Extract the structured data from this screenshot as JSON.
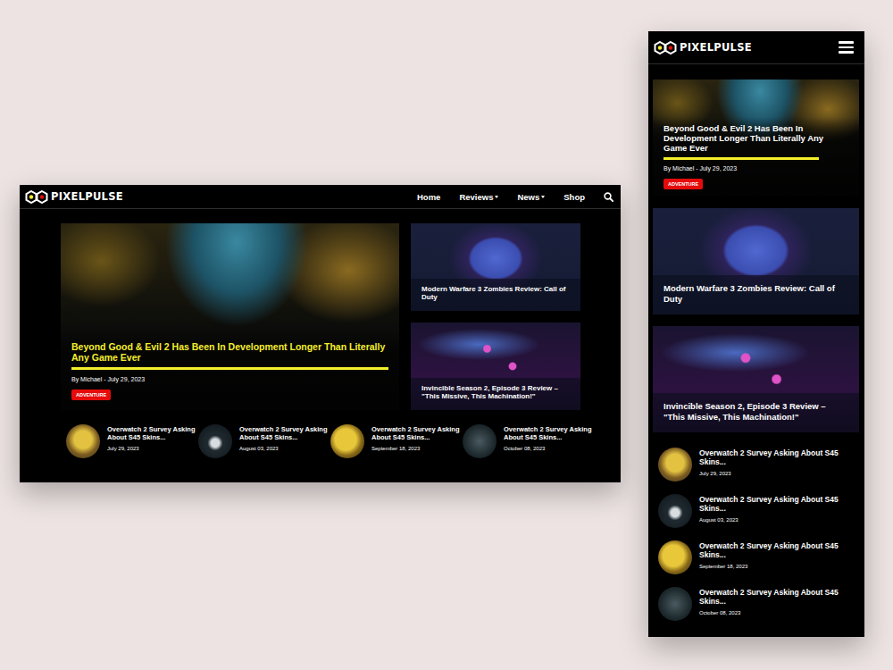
{
  "desktop": {
    "logo": "PIXELPULSE",
    "nav": [
      {
        "label": "Home",
        "dropdown": false
      },
      {
        "label": "Reviews",
        "dropdown": true
      },
      {
        "label": "News",
        "dropdown": true
      },
      {
        "label": "Shop",
        "dropdown": false
      }
    ],
    "hero": {
      "title": "Beyond Good & Evil 2 Has Been In Development Longer Than Literally Any Game Ever",
      "byline": "By Michael - July 29, 2023",
      "tag": "ADVENTURE"
    },
    "side_cards": [
      {
        "title": "Modern Warfare 3 Zombies Review: Call of Duty"
      },
      {
        "title": "Invincible Season 2, Episode 3 Review – \"This Missive, This Machination!\""
      }
    ],
    "recent": [
      {
        "title": "Overwatch 2 Survey Asking About S45 Skins...",
        "date": "July 29, 2023"
      },
      {
        "title": "Overwatch 2 Survey Asking About S45 Skins...",
        "date": "August 03, 2023"
      },
      {
        "title": "Overwatch 2 Survey Asking About S45 Skins...",
        "date": "September 18, 2023"
      },
      {
        "title": "Overwatch 2 Survey Asking About S45 Skins...",
        "date": "October 08, 2023"
      }
    ]
  },
  "mobile": {
    "logo": "PIXELPULSE",
    "hero": {
      "title": "Beyond Good & Evil 2 Has Been In Development Longer Than Literally Any Game Ever",
      "byline": "By Michael - July 29, 2023",
      "tag": "ADVENTURE"
    },
    "cards": [
      {
        "title": "Modern Warfare 3 Zombies Review: Call of Duty"
      },
      {
        "title": "Invincible Season 2, Episode 3 Review – \"This Missive, This Machination!\""
      }
    ],
    "recent": [
      {
        "title": "Overwatch 2 Survey Asking About S45 Skins...",
        "date": "July 29, 2023"
      },
      {
        "title": "Overwatch 2 Survey Asking About S45 Skins...",
        "date": "August 03, 2023"
      },
      {
        "title": "Overwatch 2 Survey Asking About S45 Skins...",
        "date": "September 18, 2023"
      },
      {
        "title": "Overwatch 2 Survey Asking About S45 Skins...",
        "date": "October 08, 2023"
      }
    ]
  }
}
